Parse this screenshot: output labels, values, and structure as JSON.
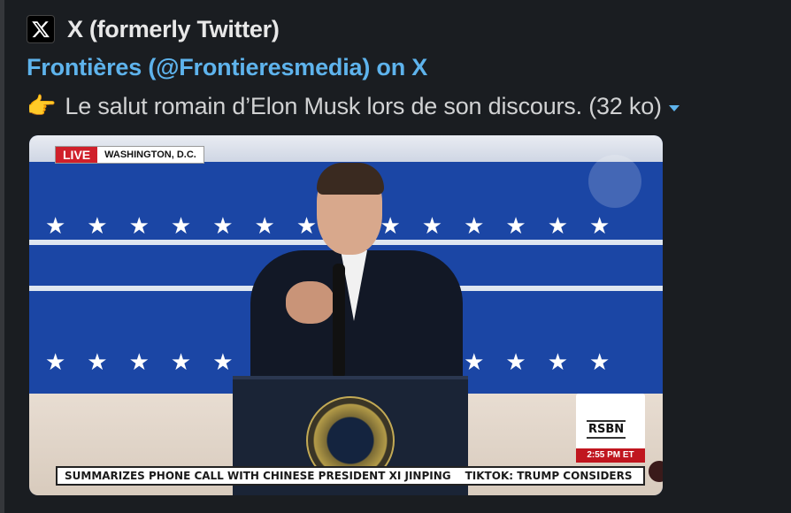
{
  "unfurl": {
    "source_name": "X (formerly Twitter)",
    "title": "Frontières (@Frontieresmedia) on X",
    "caption_emoji": "👉",
    "caption": "Le salut romain d’Elon Musk lors de son discours. (32 ko)",
    "accent_color": "#5eb3ec"
  },
  "video": {
    "live_label": "LIVE",
    "location": "WASHINGTON, D.C.",
    "rsbn_label": "RSBN",
    "time": "2:55 PM ET",
    "ticker": [
      "SUMMARIZES PHONE CALL WITH CHINESE PRESIDENT XI JINPING",
      "TIKTOK: TRUMP CONSIDERS"
    ]
  }
}
